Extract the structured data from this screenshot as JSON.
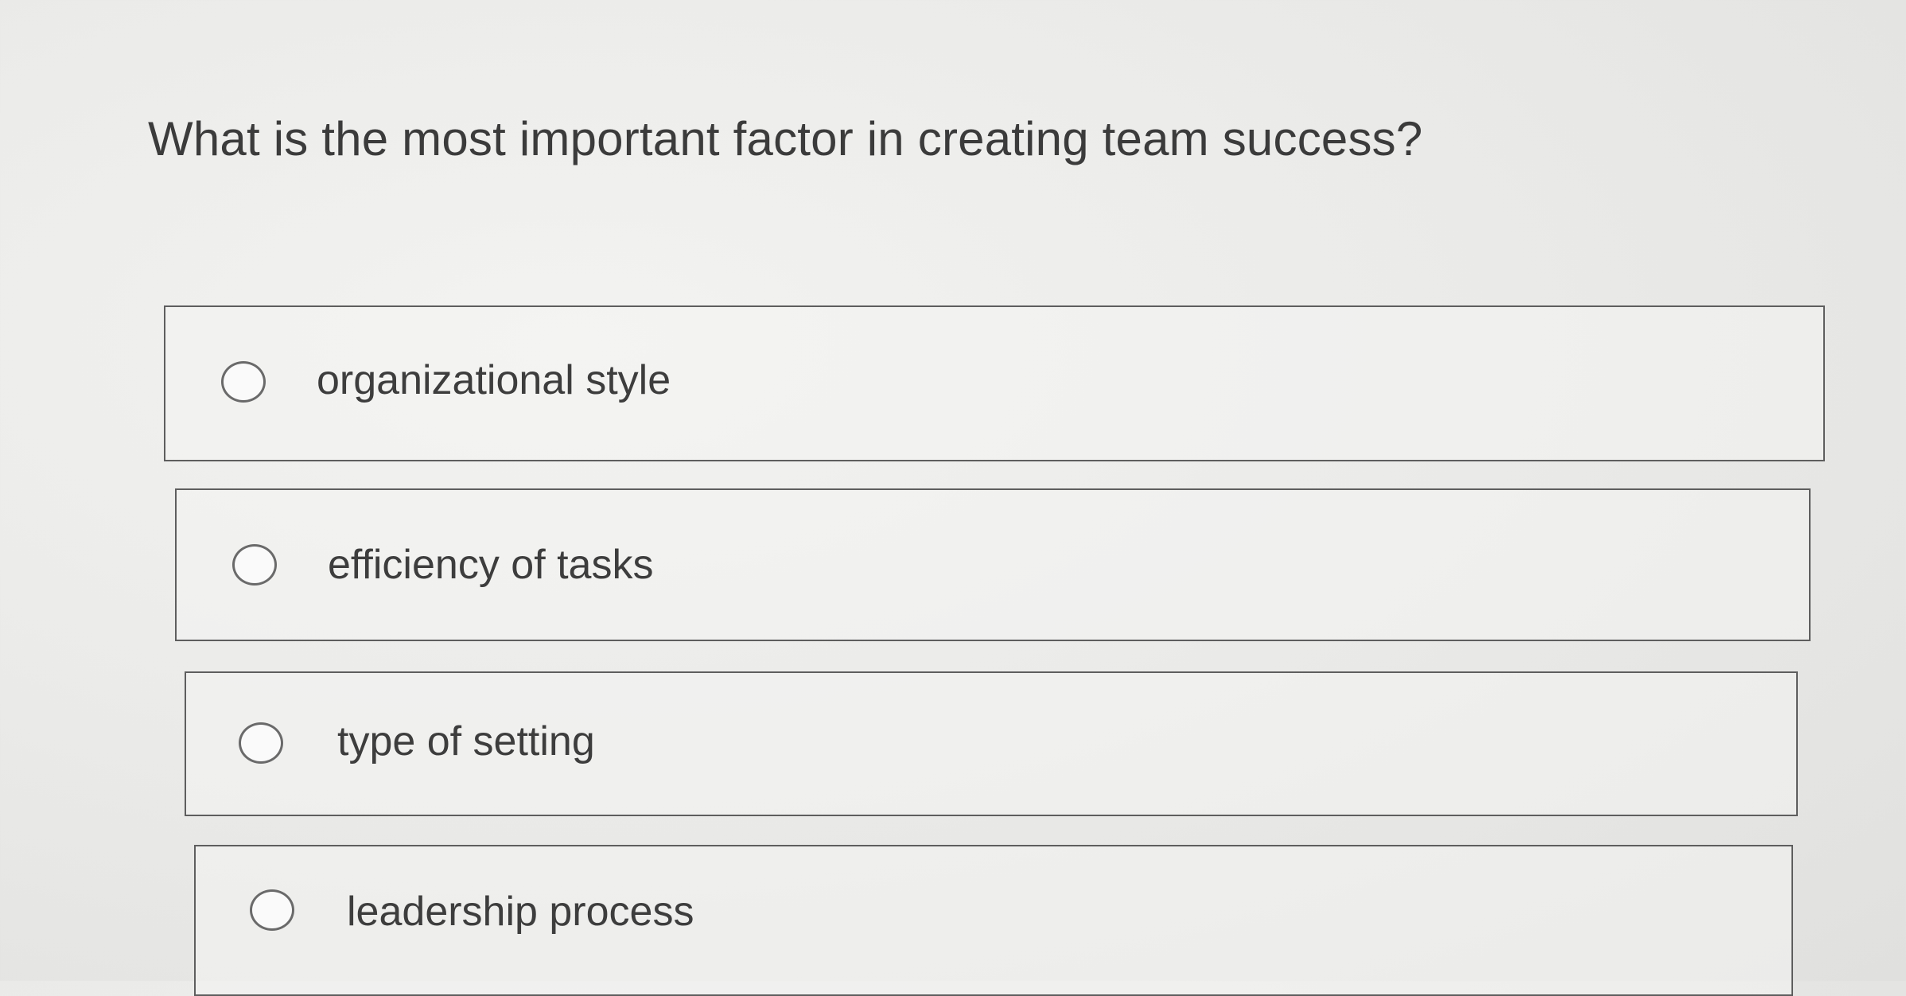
{
  "question": {
    "text": "What is the most important factor in creating team success?"
  },
  "options": [
    {
      "label": "organizational style",
      "selected": false
    },
    {
      "label": "efficiency of tasks",
      "selected": false
    },
    {
      "label": "type of setting",
      "selected": false
    },
    {
      "label": "leadership process",
      "selected": false
    }
  ]
}
